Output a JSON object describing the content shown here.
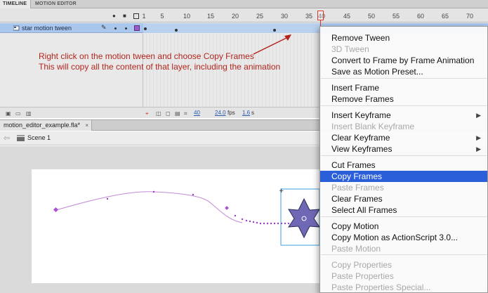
{
  "tabs": {
    "timeline": "TIMELINE",
    "motion_editor": "MOTION EDITOR"
  },
  "ruler": [
    "1",
    "5",
    "10",
    "15",
    "20",
    "25",
    "30",
    "35",
    "40",
    "45",
    "50",
    "55",
    "60",
    "65",
    "70"
  ],
  "layer": {
    "name": "star motion tween",
    "color": "#9a5cc8"
  },
  "annotation": {
    "line1": "Right click on the motion tween and choose Copy Frames",
    "line2": "This will copy all the content of that layer, including the animation"
  },
  "footer": {
    "frame": "40",
    "fps": "24.0",
    "fps_unit": "fps",
    "time": "1.6",
    "time_unit": "s"
  },
  "document": {
    "tab": "motion_editor_example.fla*",
    "close": "×",
    "scene": "Scene 1"
  },
  "menu": {
    "highlight_color": "#2b5fd9",
    "items": [
      {
        "label": "Remove Tween",
        "enabled": true
      },
      {
        "label": "3D Tween",
        "enabled": false
      },
      {
        "label": "Convert to Frame by Frame Animation",
        "enabled": true
      },
      {
        "label": "Save as Motion Preset...",
        "enabled": true
      },
      {
        "label": "Insert Frame",
        "enabled": true
      },
      {
        "label": "Remove Frames",
        "enabled": true
      },
      {
        "label": "Insert Keyframe",
        "enabled": true,
        "submenu": true
      },
      {
        "label": "Insert Blank Keyframe",
        "enabled": false
      },
      {
        "label": "Clear Keyframe",
        "enabled": true,
        "submenu": true
      },
      {
        "label": "View Keyframes",
        "enabled": true,
        "submenu": true
      },
      {
        "label": "Cut Frames",
        "enabled": true
      },
      {
        "label": "Copy Frames",
        "enabled": true,
        "highlighted": true
      },
      {
        "label": "Paste Frames",
        "enabled": false
      },
      {
        "label": "Clear Frames",
        "enabled": true
      },
      {
        "label": "Select All Frames",
        "enabled": true
      },
      {
        "label": "Copy Motion",
        "enabled": true
      },
      {
        "label": "Copy Motion as ActionScript 3.0...",
        "enabled": true
      },
      {
        "label": "Paste Motion",
        "enabled": false
      },
      {
        "label": "Copy Properties",
        "enabled": false
      },
      {
        "label": "Paste Properties",
        "enabled": false
      },
      {
        "label": "Paste Properties Special...",
        "enabled": false
      }
    ]
  }
}
